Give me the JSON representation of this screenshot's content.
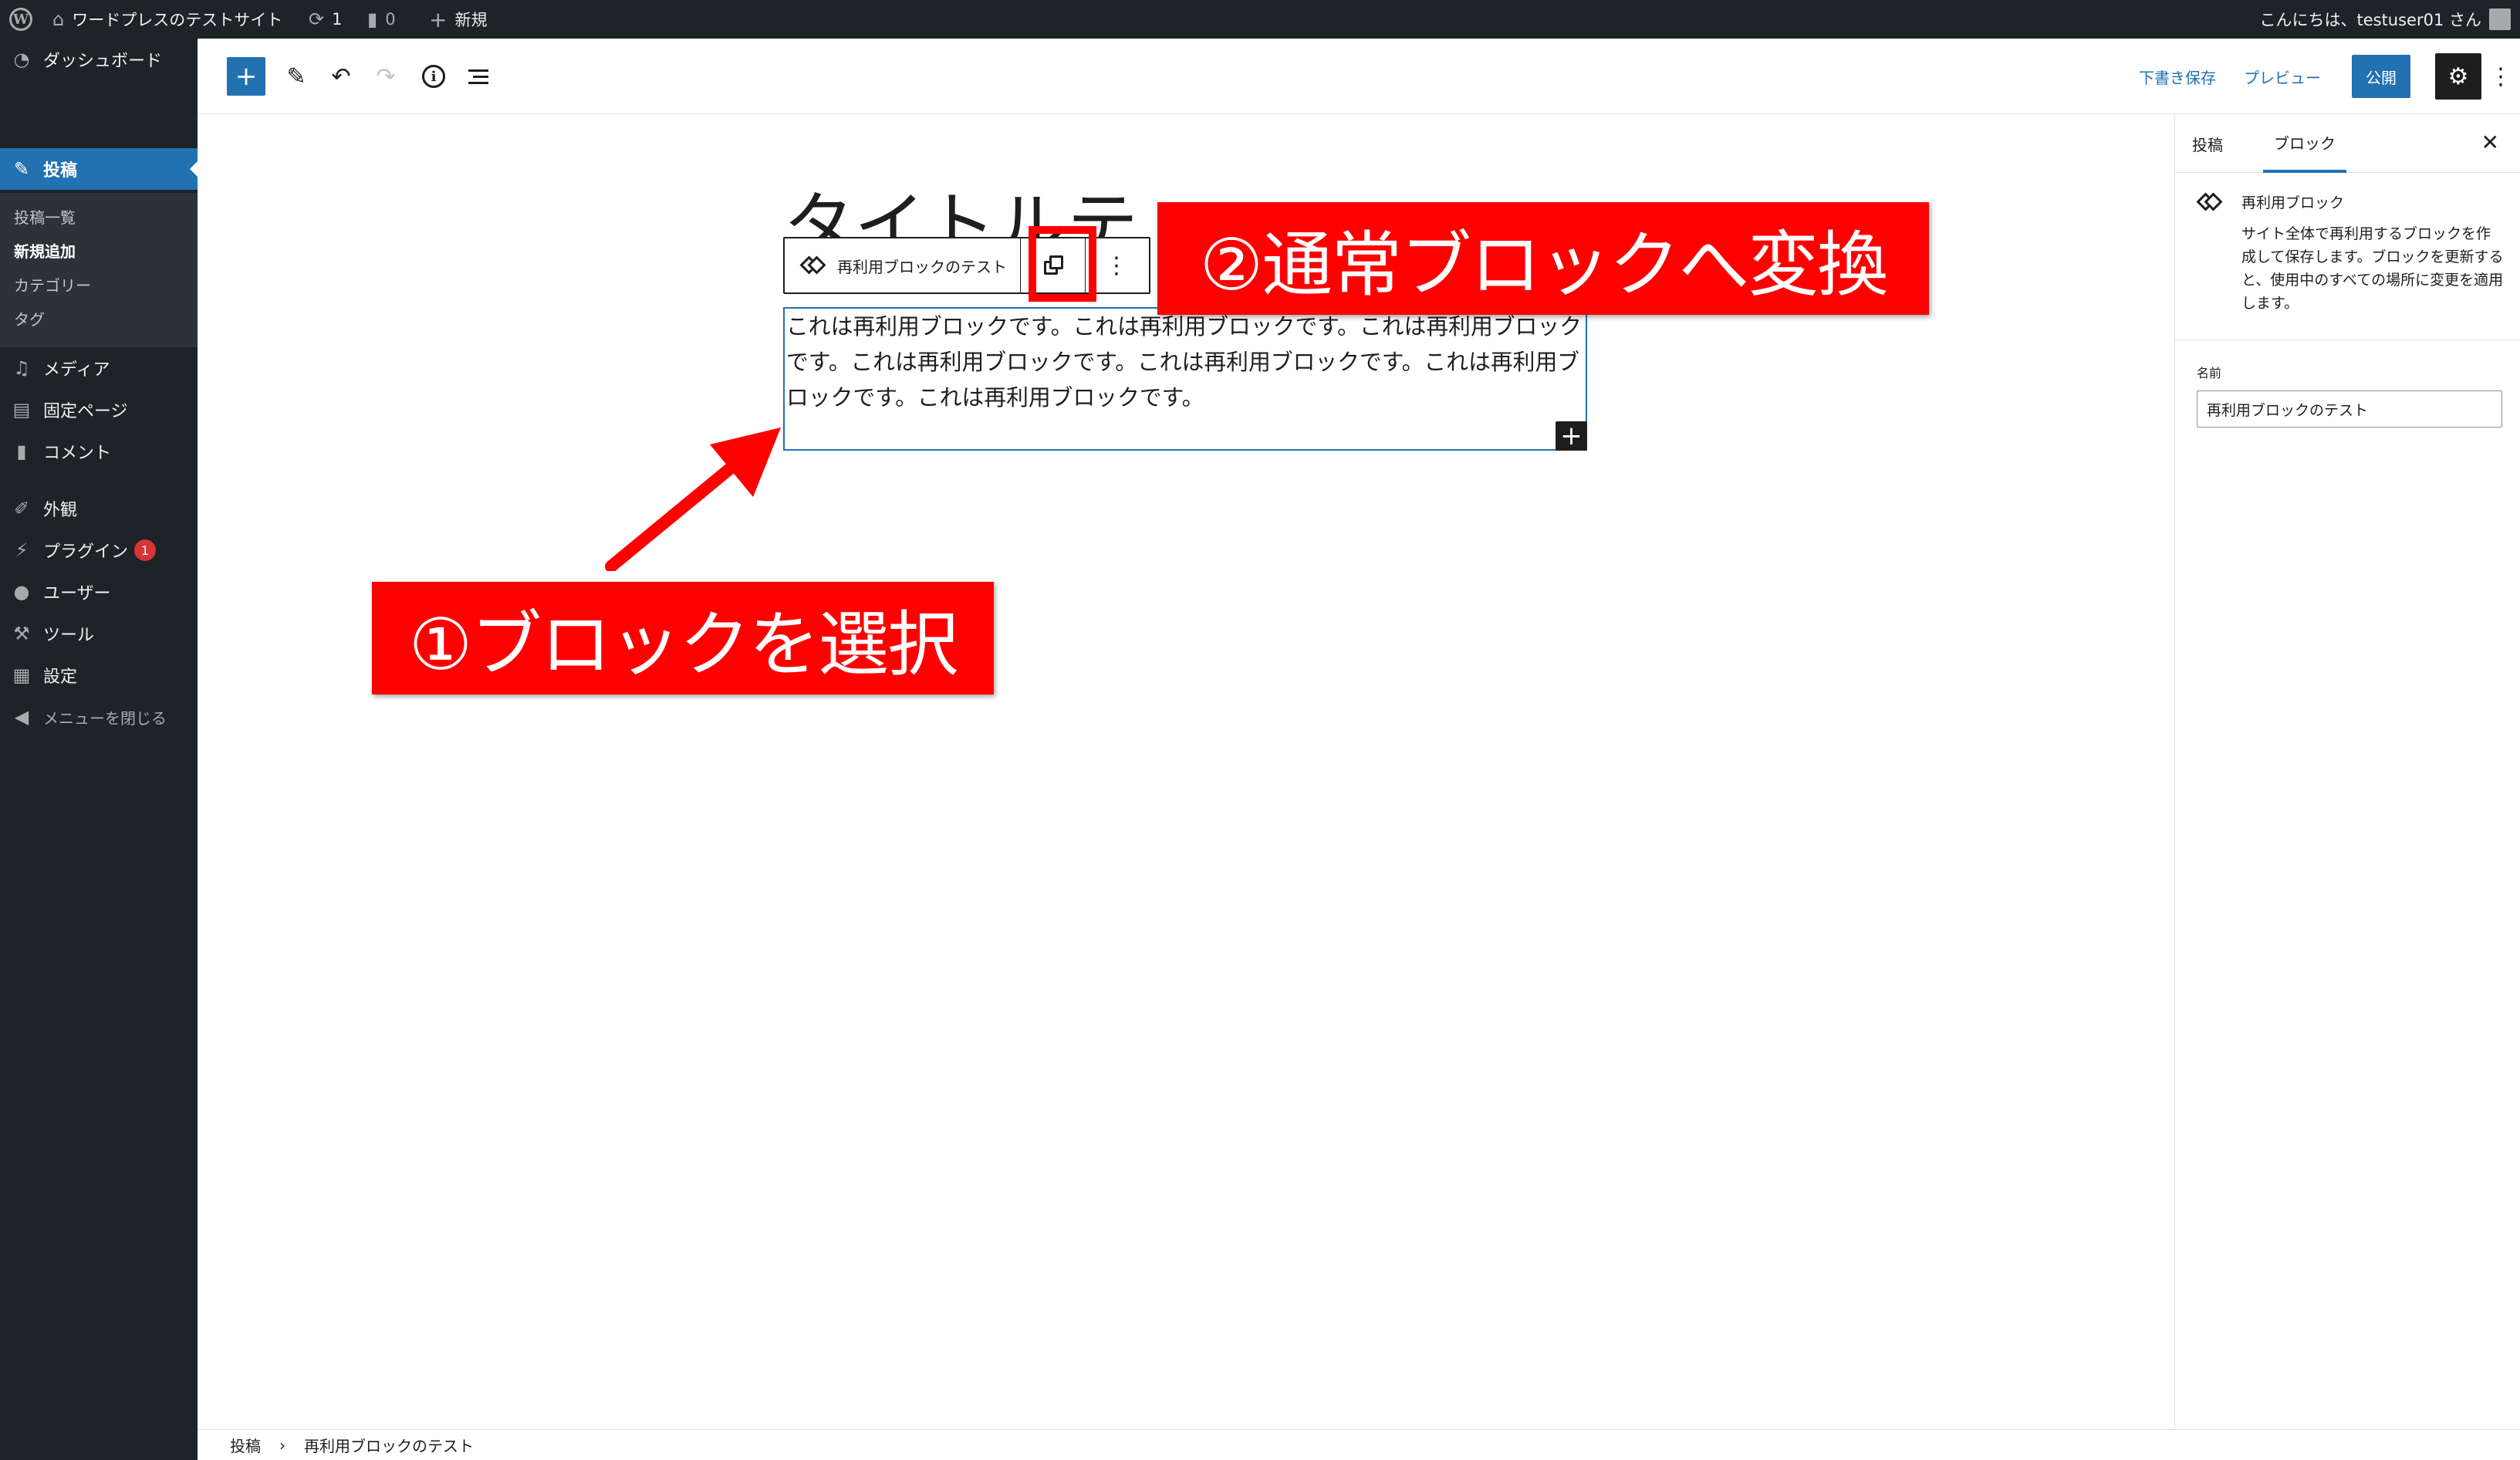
{
  "admin_bar": {
    "site_name": "ワードプレスのテストサイト",
    "updates_count": "1",
    "comments_count": "0",
    "new_label": "新規",
    "greeting": "こんにちは、testuser01 さん"
  },
  "sidebar": {
    "dashboard": "ダッシュボード",
    "posts": "投稿",
    "posts_submenu": [
      "投稿一覧",
      "新規追加",
      "カテゴリー",
      "タグ"
    ],
    "media": "メディア",
    "pages": "固定ページ",
    "comments": "コメント",
    "appearance": "外観",
    "plugins": "プラグイン",
    "plugins_badge": "1",
    "users": "ユーザー",
    "tools": "ツール",
    "settings": "設定",
    "collapse": "メニューを閉じる"
  },
  "editor_header": {
    "save_draft": "下書き保存",
    "preview": "プレビュー",
    "publish": "公開"
  },
  "canvas": {
    "title": "タイトルテ",
    "block_toolbar_label": "再利用ブロックのテスト",
    "block_text": "これは再利用ブロックです。これは再利用ブロックです。これは再利用ブロックです。これは再利用ブロックです。これは再利用ブロックです。これは再利用ブロックです。これは再利用ブロックです。"
  },
  "annotations": {
    "step1": "①ブロックを選択",
    "step2": "②通常ブロックへ変換"
  },
  "settings_panel": {
    "tab_post": "投稿",
    "tab_block": "ブロック",
    "block_title": "再利用ブロック",
    "block_description": "サイト全体で再利用するブロックを作成して保存します。ブロックを更新すると、使用中のすべての場所に変更を適用します。",
    "name_label": "名前",
    "name_value": "再利用ブロックのテスト"
  },
  "footer": {
    "crumb_root": "投稿",
    "crumb_current": "再利用ブロックのテスト"
  },
  "colors": {
    "admin_dark": "#1d2327",
    "accent_blue": "#2271b1",
    "annotation_red": "#ff0000"
  }
}
